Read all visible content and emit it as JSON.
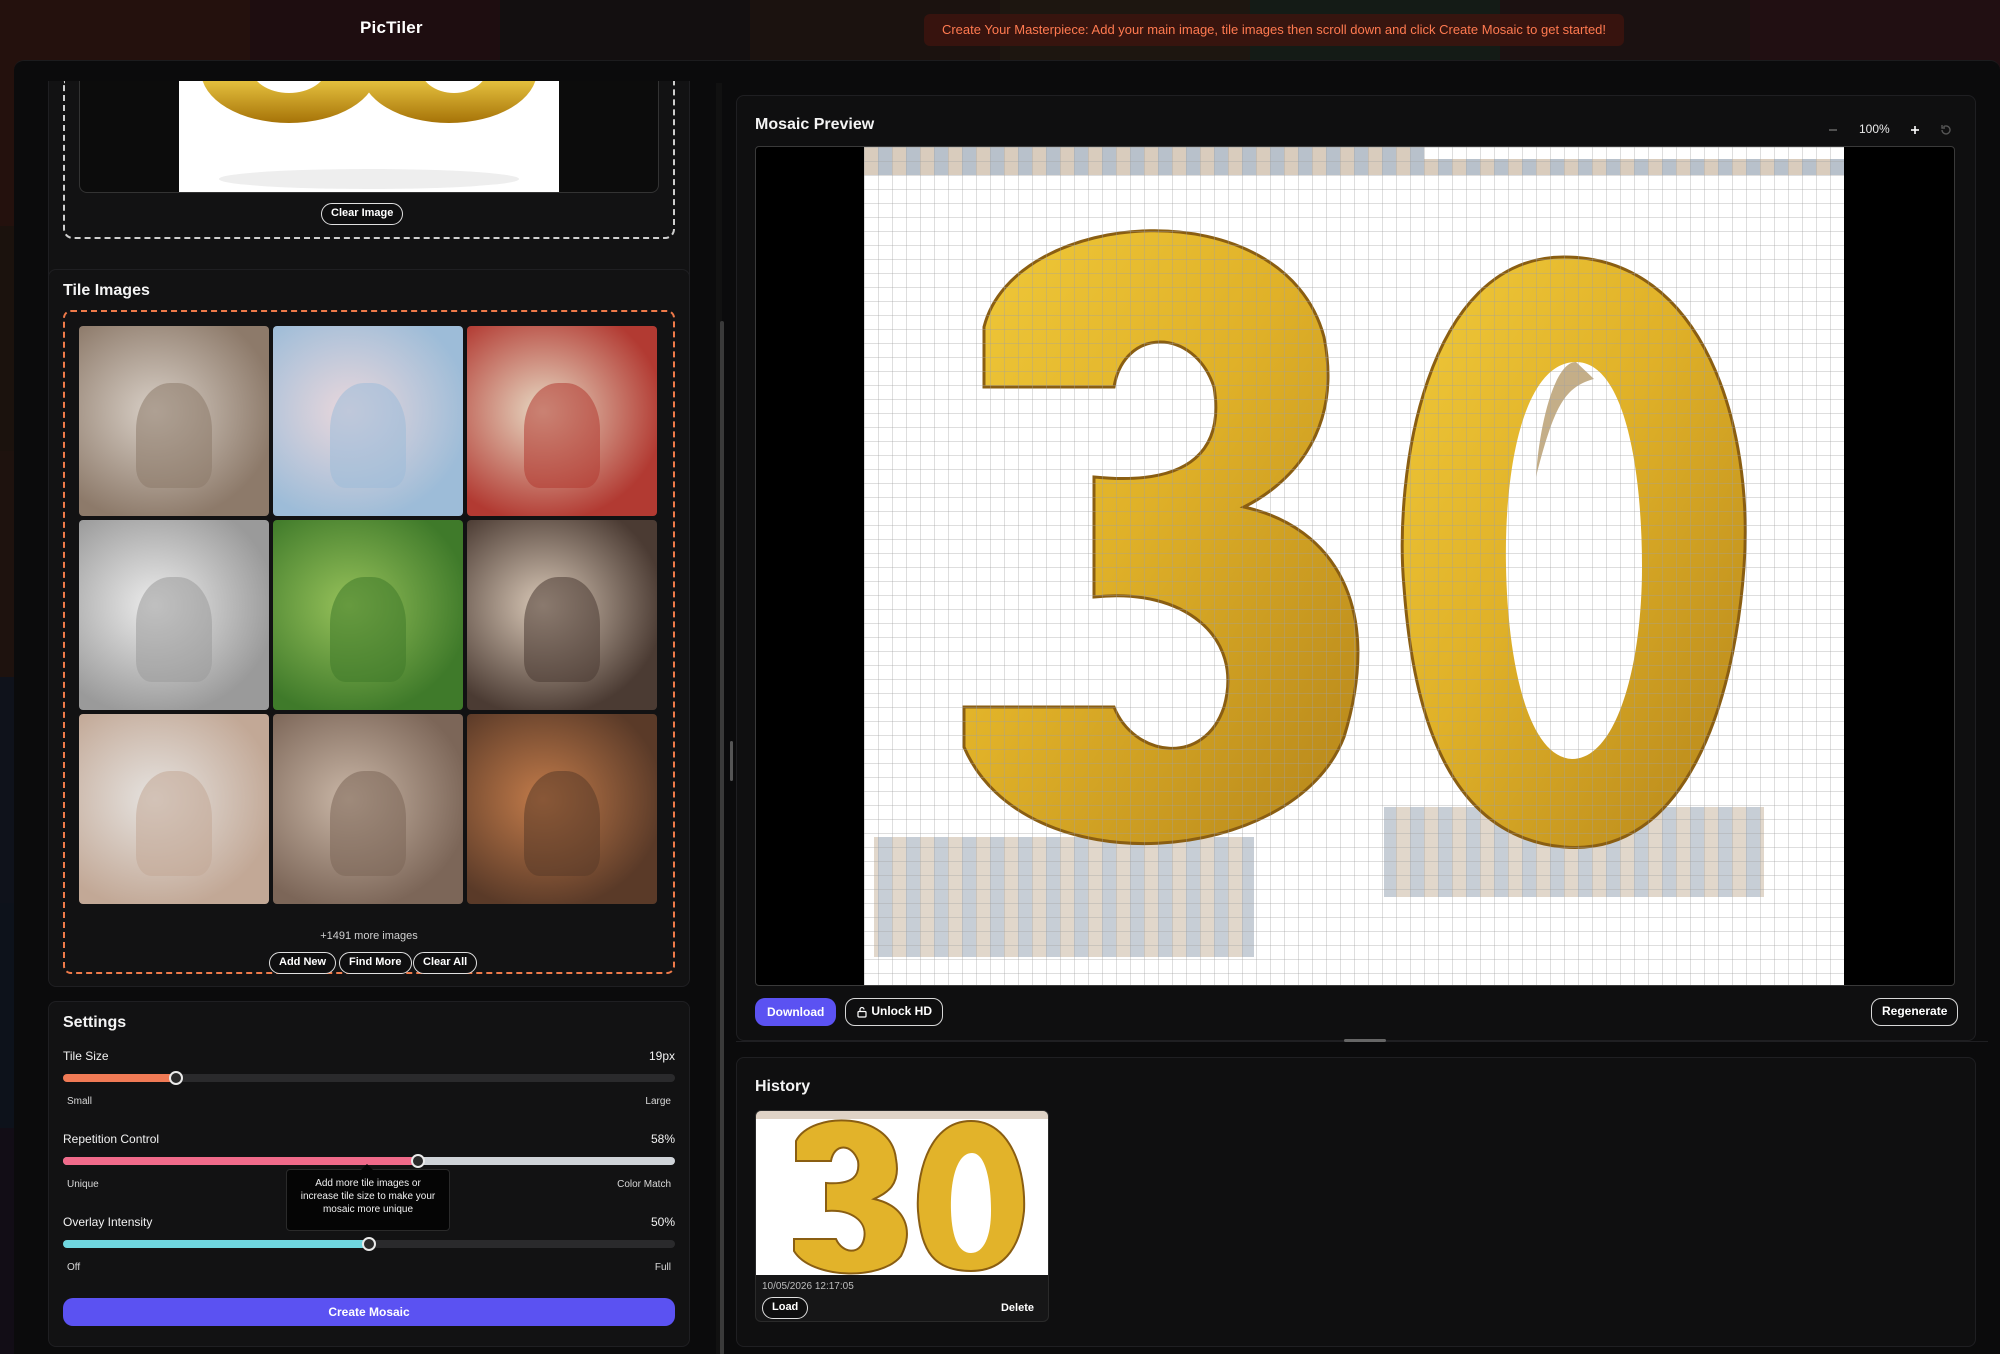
{
  "app": {
    "brand": "PicTiler"
  },
  "banner": {
    "text": "Create Your Masterpiece: Add your main image, tile images then scroll down and click Create Mosaic to get started!"
  },
  "main_image": {
    "clear_label": "Clear Image"
  },
  "tiles": {
    "title": "Tile Images",
    "more_text": "+1491 more images",
    "add_label": "Add New",
    "find_label": "Find More",
    "clear_label": "Clear All",
    "photos": [
      {
        "desc": "family-on-couch",
        "c1": "#8d7a6a",
        "c2": "#d8cfc6"
      },
      {
        "desc": "grandparents-smiling",
        "c1": "#9dbcd8",
        "c2": "#e9d7dc"
      },
      {
        "desc": "kids-party",
        "c1": "#b23a32",
        "c2": "#e7d9c3"
      },
      {
        "desc": "father-daughter-brushing",
        "c1": "#9a9a9a",
        "c2": "#ececec"
      },
      {
        "desc": "kids-playing-in-park",
        "c1": "#3f7a2a",
        "c2": "#96c15a"
      },
      {
        "desc": "mother-daughter-hug",
        "c1": "#4b3b33",
        "c2": "#d8c7b6"
      },
      {
        "desc": "baby-hand",
        "c1": "#c2a896",
        "c2": "#e6e3e0"
      },
      {
        "desc": "father-newborn",
        "c1": "#7c6658",
        "c2": "#c9b6a6"
      },
      {
        "desc": "elderly-couple-laptop",
        "c1": "#5a3a28",
        "c2": "#c27b4a"
      }
    ]
  },
  "settings": {
    "title": "Settings",
    "tile_size": {
      "label": "Tile Size",
      "value": "19px",
      "min_label": "Small",
      "max_label": "Large",
      "fraction": 0.184,
      "color": "#f07a55"
    },
    "repetition": {
      "label": "Repetition Control",
      "value": "58%",
      "min_label": "Unique",
      "max_label": "Color Match",
      "fraction": 0.58,
      "color": "#f06a8a"
    },
    "overlay": {
      "label": "Overlay Intensity",
      "value": "50%",
      "min_label": "Off",
      "max_label": "Full",
      "fraction": 0.5,
      "color": "#6fd6df"
    },
    "tooltip": "Add more tile images or increase tile size to make your mosaic more unique",
    "create_label": "Create Mosaic"
  },
  "preview": {
    "title": "Mosaic Preview",
    "zoom": "100%",
    "zoom_out_icon": "minus-icon",
    "zoom_in_icon": "plus-icon",
    "reset_icon": "reset-icon",
    "download_label": "Download",
    "unlock_label": "Unlock HD",
    "regenerate_label": "Regenerate"
  },
  "history": {
    "title": "History",
    "items": [
      {
        "date": "10/05/2026 12:17:05",
        "load_label": "Load",
        "delete_label": "Delete"
      }
    ]
  },
  "colors": {
    "accent": "#5b52f2",
    "orange": "#ef7a4a",
    "gold": "#e2b32a"
  }
}
